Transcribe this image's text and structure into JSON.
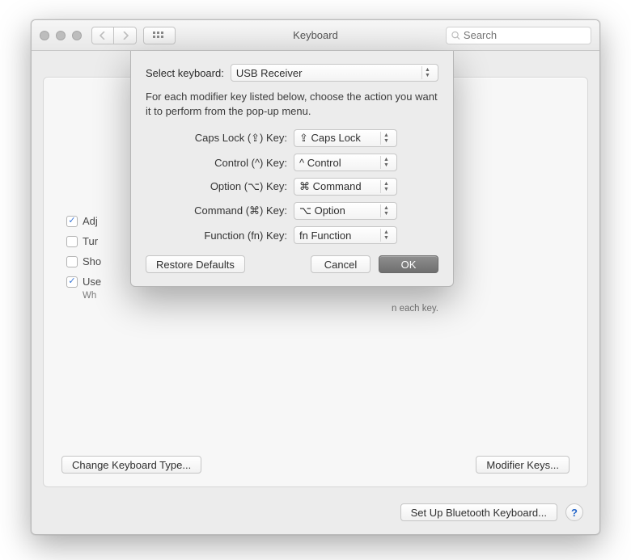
{
  "window": {
    "title": "Keyboard"
  },
  "search": {
    "placeholder": "Search"
  },
  "checks": {
    "adjust": "Adj",
    "turn": "Tur",
    "show": "Sho",
    "use": "Use",
    "use_note_left": "Wh",
    "use_note_right": "n each key."
  },
  "bottom": {
    "change_type": "Change Keyboard Type...",
    "modifier_keys": "Modifier Keys..."
  },
  "footer": {
    "setup_bt": "Set Up Bluetooth Keyboard...",
    "help": "?"
  },
  "sheet": {
    "select_keyboard_label": "Select keyboard:",
    "select_keyboard_value": "USB Receiver",
    "instruction": "For each modifier key listed below, choose the action you want it to perform from the pop-up menu.",
    "rows": [
      {
        "label": "Caps Lock (⇪) Key:",
        "value": "⇪ Caps Lock"
      },
      {
        "label": "Control (^) Key:",
        "value": "^ Control"
      },
      {
        "label": "Option (⌥) Key:",
        "value": "⌘ Command"
      },
      {
        "label": "Command (⌘) Key:",
        "value": "⌥ Option"
      },
      {
        "label": "Function (fn) Key:",
        "value": "fn Function"
      }
    ],
    "restore": "Restore Defaults",
    "cancel": "Cancel",
    "ok": "OK"
  }
}
